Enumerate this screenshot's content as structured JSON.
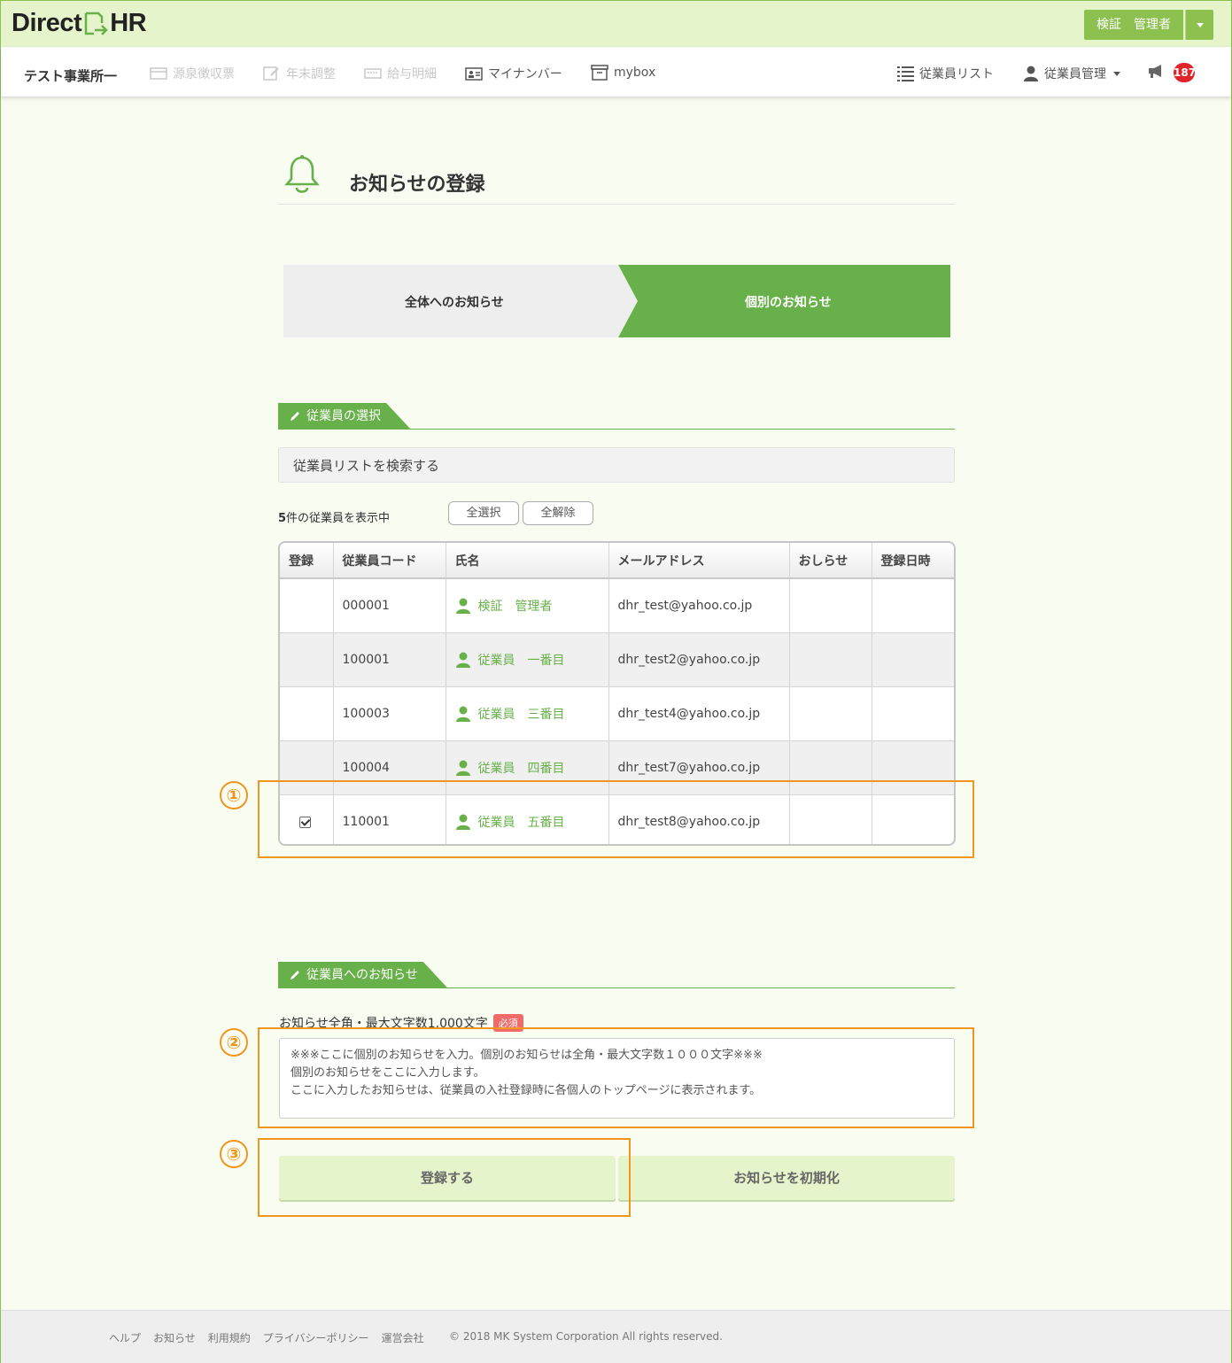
{
  "app": {
    "logo_left": "Direct",
    "logo_right": "HR",
    "user_name": "検証　管理者"
  },
  "nav": {
    "office": "テスト事業所一",
    "items": [
      {
        "label": "源泉徴収票",
        "icon": "card-icon"
      },
      {
        "label": "年末調整",
        "icon": "edit-document-icon"
      },
      {
        "label": "給与明細",
        "icon": "keyboard-icon"
      },
      {
        "label": "マイナンバー",
        "icon": "id-card-icon"
      },
      {
        "label": "mybox",
        "icon": "box-icon"
      }
    ],
    "right_items": [
      {
        "label": "従業員リスト",
        "icon": "list-icon"
      },
      {
        "label": "従業員管理",
        "icon": "user-icon"
      }
    ],
    "notification_count": "187"
  },
  "page": {
    "title": "お知らせの登録",
    "tabs": [
      {
        "label": "全体へのお知らせ",
        "active": false
      },
      {
        "label": "個別のお知らせ",
        "active": true
      }
    ]
  },
  "employee_section": {
    "heading": "従業員の選択",
    "search_label": "従業員リストを検索する",
    "count_number": "5",
    "count_suffix": "件の従業員を表示中",
    "select_all": "全選択",
    "deselect_all": "全解除",
    "columns": [
      "登録",
      "従業員コード",
      "氏名",
      "メールアドレス",
      "おしらせ",
      "登録日時"
    ],
    "rows": [
      {
        "checked": false,
        "code": "000001",
        "name": "検証　管理者",
        "email": "dhr_test@yahoo.co.jp",
        "notice": "",
        "date": ""
      },
      {
        "checked": false,
        "code": "100001",
        "name": "従業員　一番目",
        "email": "dhr_test2@yahoo.co.jp",
        "notice": "",
        "date": ""
      },
      {
        "checked": false,
        "code": "100003",
        "name": "従業員　三番目",
        "email": "dhr_test4@yahoo.co.jp",
        "notice": "",
        "date": ""
      },
      {
        "checked": false,
        "code": "100004",
        "name": "従業員　四番目",
        "email": "dhr_test7@yahoo.co.jp",
        "notice": "",
        "date": ""
      },
      {
        "checked": true,
        "code": "110001",
        "name": "従業員　五番目",
        "email": "dhr_test8@yahoo.co.jp",
        "notice": "",
        "date": ""
      }
    ]
  },
  "notice_section": {
    "heading": "従業員へのお知らせ",
    "label": "お知らせ全角・最大文字数1,000文字",
    "required": "必須",
    "text": "※※※ここに個別のお知らせを入力。個別のお知らせは全角・最大文字数１０００文字※※※\n個別のお知らせをここに入力します。\nここに入力したお知らせは、従業員の入社登録時に各個人のトップページに表示されます。",
    "register_button": "登録する",
    "reset_button": "お知らせを初期化"
  },
  "annotations": [
    "①",
    "②",
    "③"
  ],
  "footer": {
    "links": [
      "ヘルプ",
      "お知らせ",
      "利用規約",
      "プライバシーポリシー",
      "運営会社"
    ],
    "copyright": "© 2018 MK System Corporation All rights reserved."
  },
  "colors": {
    "brand_green": "#68b04a",
    "light_green": "#e6f4cc",
    "annotation_orange": "#f0961e",
    "badge_red": "#e0252a"
  }
}
